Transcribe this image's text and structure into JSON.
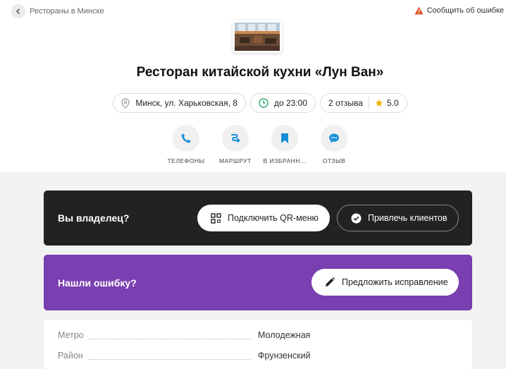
{
  "topbar": {
    "back_label": "Рестораны в Минске",
    "report_label": "Сообщить об ошибке"
  },
  "restaurant": {
    "name": "Ресторан китайской кухни «Лун Ван»"
  },
  "chips": {
    "address": "Минск, ул. Харьковская, 8",
    "hours": "до 23:00",
    "reviews": "2 отзыва",
    "rating": "5.0"
  },
  "actions": [
    {
      "label": "ТЕЛЕФОНЫ",
      "icon": "phone-icon"
    },
    {
      "label": "МАРШРУТ",
      "icon": "route-icon"
    },
    {
      "label": "В ИЗБРАНН...",
      "icon": "bookmark-icon"
    },
    {
      "label": "ОТЗЫВ",
      "icon": "chat-icon"
    }
  ],
  "owner_card": {
    "title": "Вы владелец?",
    "qr_button": "Подключить QR-меню",
    "clients_button": "Привлечь клиентов"
  },
  "error_card": {
    "title": "Нашли ошибку?",
    "suggest_button": "Предложить исправление"
  },
  "details": [
    {
      "key": "Метро",
      "value": "Молодежная"
    },
    {
      "key": "Район",
      "value": "Фрунзенский"
    }
  ],
  "colors": {
    "accent_blue": "#1a8fd8",
    "hours_green": "#2eaa6a",
    "warning_orange": "#e8532c",
    "owner_bg": "#222222",
    "error_bg": "#7a3fb0",
    "star": "#f5b400"
  }
}
